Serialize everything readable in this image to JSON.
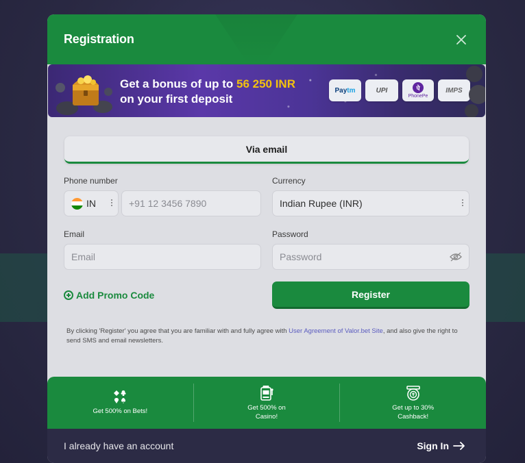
{
  "modal": {
    "title": "Registration",
    "close_icon": "close-icon"
  },
  "banner": {
    "line1_prefix": "Get a bonus of up to ",
    "amount": "56 250 INR",
    "line2": "on your first deposit",
    "payments": {
      "paytm_a": "Pay",
      "paytm_b": "tm",
      "upi": "UPI",
      "phonepe": "PhonePe",
      "phonepe_mark": "पे",
      "imps": "IMPS"
    }
  },
  "tabs": {
    "active_label": "Via email"
  },
  "form": {
    "phone_label": "Phone number",
    "country_code": "IN",
    "phone_placeholder": "+91 12 3456 7890",
    "currency_label": "Currency",
    "currency_value": "Indian Rupee (INR)",
    "email_label": "Email",
    "email_placeholder": "Email",
    "password_label": "Password",
    "password_placeholder": "Password",
    "promo_label": "Add Promo Code",
    "register_label": "Register"
  },
  "terms": {
    "prefix": "By clicking 'Register' you agree that you are familiar with and fully agree with ",
    "link": "User Agreement of Valor.bet Site",
    "suffix": ", and also give the right to send SMS and email newsletters."
  },
  "bonuses": [
    {
      "icon": "cards-suits-icon",
      "label": "Get 500% on Bets!"
    },
    {
      "icon": "slot-machine-icon",
      "label": "Get 500% on Casino!"
    },
    {
      "icon": "cashback-icon",
      "label": "Get up to 30% Cashback!"
    }
  ],
  "footer": {
    "have_account": "I already have an account",
    "signin_label": "Sign In"
  },
  "colors": {
    "brand_green": "#1a8a3e",
    "banner_amount": "#f4c20d",
    "link": "#5a5bbf",
    "footer_bg": "#2c2b45"
  }
}
